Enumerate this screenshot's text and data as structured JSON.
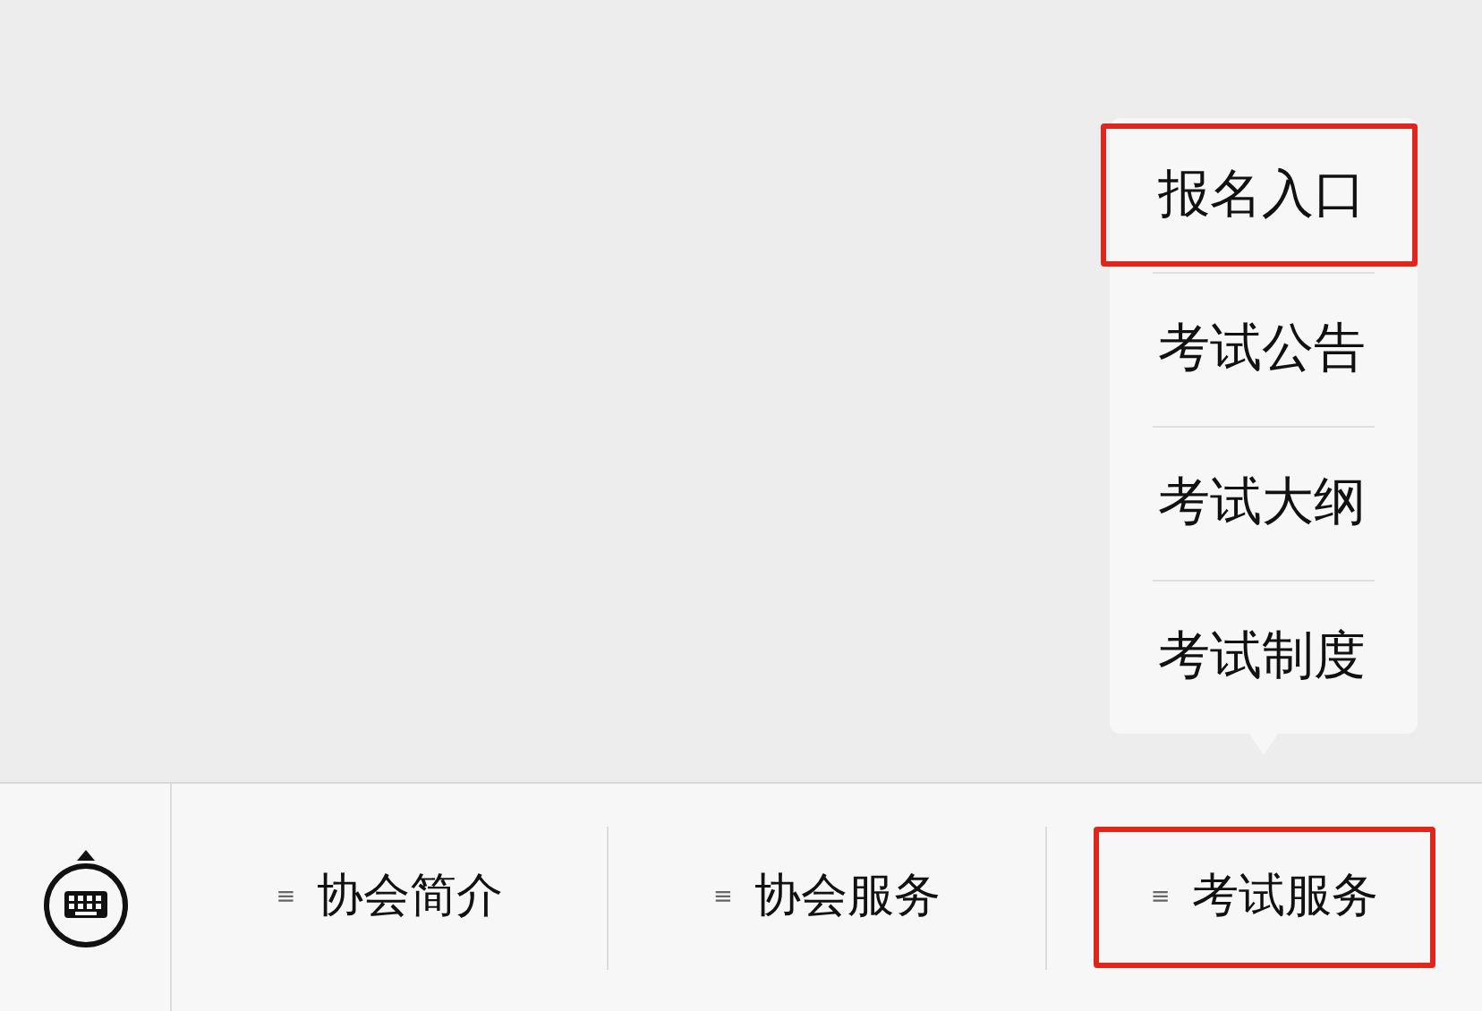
{
  "submenu": {
    "items": [
      {
        "label": "报名入口",
        "highlighted": true
      },
      {
        "label": "考试公告",
        "highlighted": false
      },
      {
        "label": "考试大纲",
        "highlighted": false
      },
      {
        "label": "考试制度",
        "highlighted": false
      }
    ]
  },
  "menu_bar": {
    "items": [
      {
        "icon": "≡",
        "label": "协会简介",
        "highlighted": false
      },
      {
        "icon": "≡",
        "label": "协会服务",
        "highlighted": false
      },
      {
        "icon": "≡",
        "label": "考试服务",
        "highlighted": true
      }
    ]
  }
}
